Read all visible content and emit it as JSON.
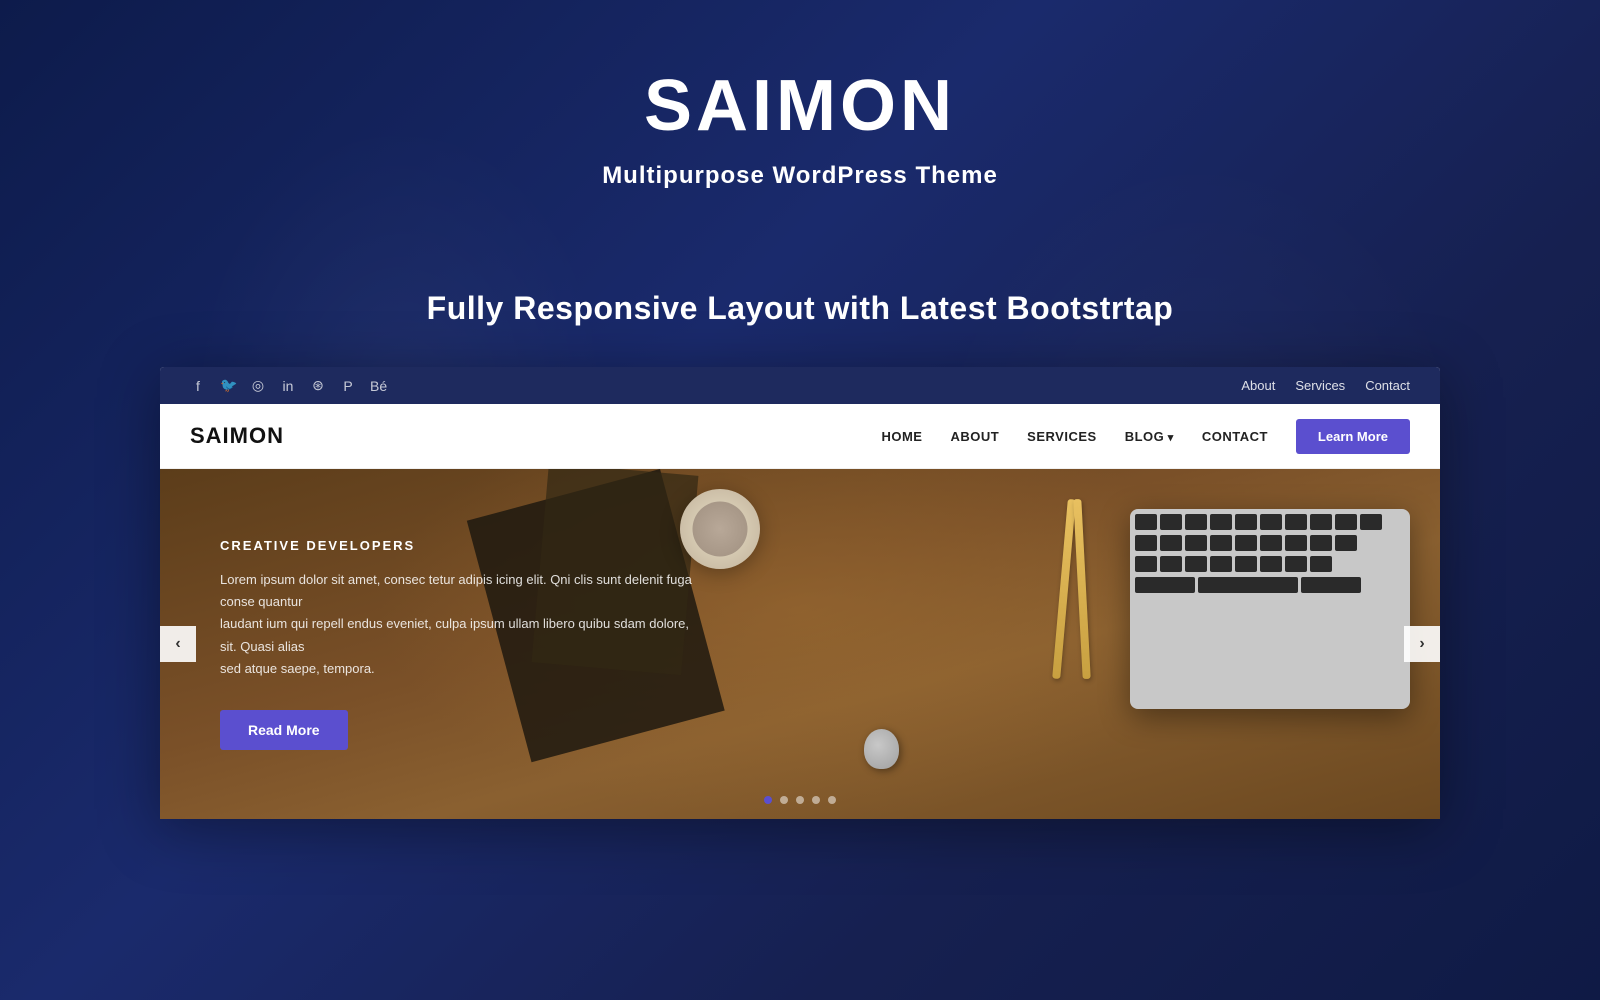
{
  "hero": {
    "title": "SAIMON",
    "subtitle": "Multipurpose WordPress Theme",
    "tagline": "Fully Responsive Layout with Latest Bootstrtap"
  },
  "demo": {
    "topbar": {
      "social_icons": [
        "f",
        "t",
        "in",
        "li",
        "d",
        "p",
        "be"
      ],
      "links": [
        "About",
        "Services",
        "Contact"
      ]
    },
    "navbar": {
      "logo": "SAIMON",
      "nav_items": [
        {
          "label": "HOME",
          "has_dropdown": false
        },
        {
          "label": "ABOUT",
          "has_dropdown": false
        },
        {
          "label": "SERVICES",
          "has_dropdown": false
        },
        {
          "label": "BLOG",
          "has_dropdown": true
        },
        {
          "label": "CONTACT",
          "has_dropdown": false
        }
      ],
      "cta_label": "Learn More"
    },
    "hero": {
      "eyebrow": "CREATIVE DEVELOPERS",
      "body_line1": "Lorem ipsum dolor sit amet, consec tetur adipis icing elit. Qni clis sunt delenit fuga conse quantur",
      "body_line2": "laudant ium qui repell endus eveniet, culpa ipsum ullam libero quibu sdam dolore, sit. Quasi alias",
      "body_line3": "sed atque saepe, tempora.",
      "cta_label": "Read More"
    },
    "slider": {
      "prev_label": "‹",
      "next_label": "›",
      "dots": [
        true,
        false,
        false,
        false,
        false
      ]
    }
  },
  "colors": {
    "accent": "#5b4fcf",
    "dark_blue": "#1e2a5e",
    "white": "#ffffff"
  }
}
